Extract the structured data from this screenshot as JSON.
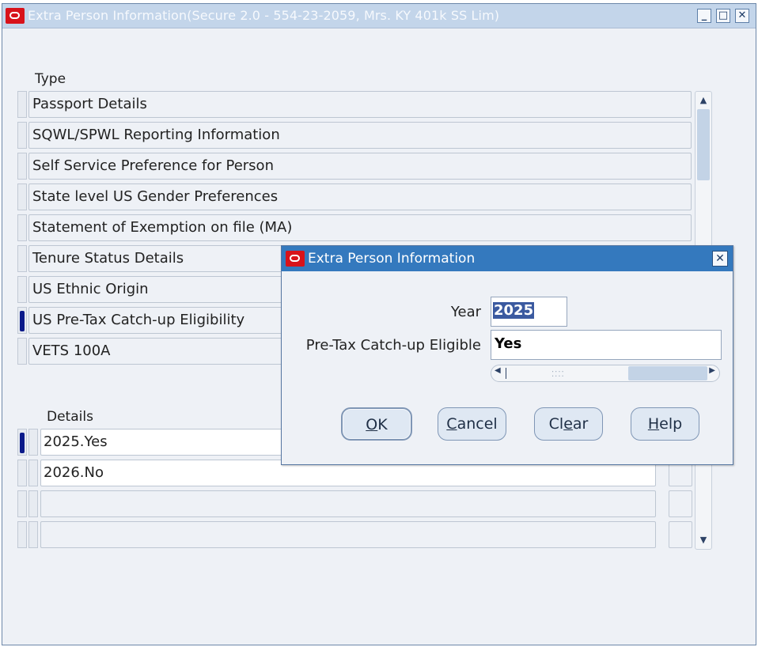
{
  "window": {
    "title": "Extra Person Information(Secure 2.0 - 554-23-2059, Mrs. KY 401k SS Lim)",
    "controls": {
      "minimize": "_",
      "maximize": "□",
      "close": "✕"
    }
  },
  "type_section": {
    "label": "Type",
    "rows": [
      {
        "label": "Passport Details",
        "active": false
      },
      {
        "label": "SQWL/SPWL Reporting Information",
        "active": false
      },
      {
        "label": "Self Service Preference for Person",
        "active": false
      },
      {
        "label": "State level US Gender Preferences",
        "active": false
      },
      {
        "label": "Statement of Exemption on file (MA)",
        "active": false
      },
      {
        "label": "Tenure Status Details",
        "active": false
      },
      {
        "label": "US Ethnic Origin",
        "active": false
      },
      {
        "label": "US Pre-Tax Catch-up Eligibility",
        "active": true
      },
      {
        "label": "VETS 100A",
        "active": false
      }
    ]
  },
  "details_section": {
    "label": "Details",
    "rows": [
      {
        "value": "2025.Yes",
        "active": true
      },
      {
        "value": "2026.No",
        "active": false
      },
      {
        "value": "",
        "active": false
      },
      {
        "value": "",
        "active": false
      }
    ]
  },
  "dialog": {
    "title": "Extra Person Information",
    "close": "✕",
    "fields": {
      "year_label": "Year",
      "year_value": "2025",
      "eligible_label": "Pre-Tax Catch-up Eligible",
      "eligible_value": "Yes"
    },
    "buttons": {
      "ok_first": "O",
      "ok_rest": "K",
      "cancel_first": "C",
      "cancel_rest": "ancel",
      "clear_first": "Cl",
      "clear_ul": "e",
      "clear_rest": "ar",
      "help_first": "H",
      "help_rest": "elp"
    }
  },
  "colors": {
    "titlebar_inactive": "#c3d5ea",
    "dialog_titlebar": "#3479be",
    "oracle_red": "#d8121a",
    "row_indicator": "#0b1a8a",
    "selection": "#3b5aa0"
  },
  "icons": [
    "oracle-logo-icon",
    "minimize-icon",
    "maximize-icon",
    "close-icon",
    "arrow-up-icon",
    "arrow-down-icon",
    "arrow-left-icon",
    "arrow-right-icon"
  ]
}
